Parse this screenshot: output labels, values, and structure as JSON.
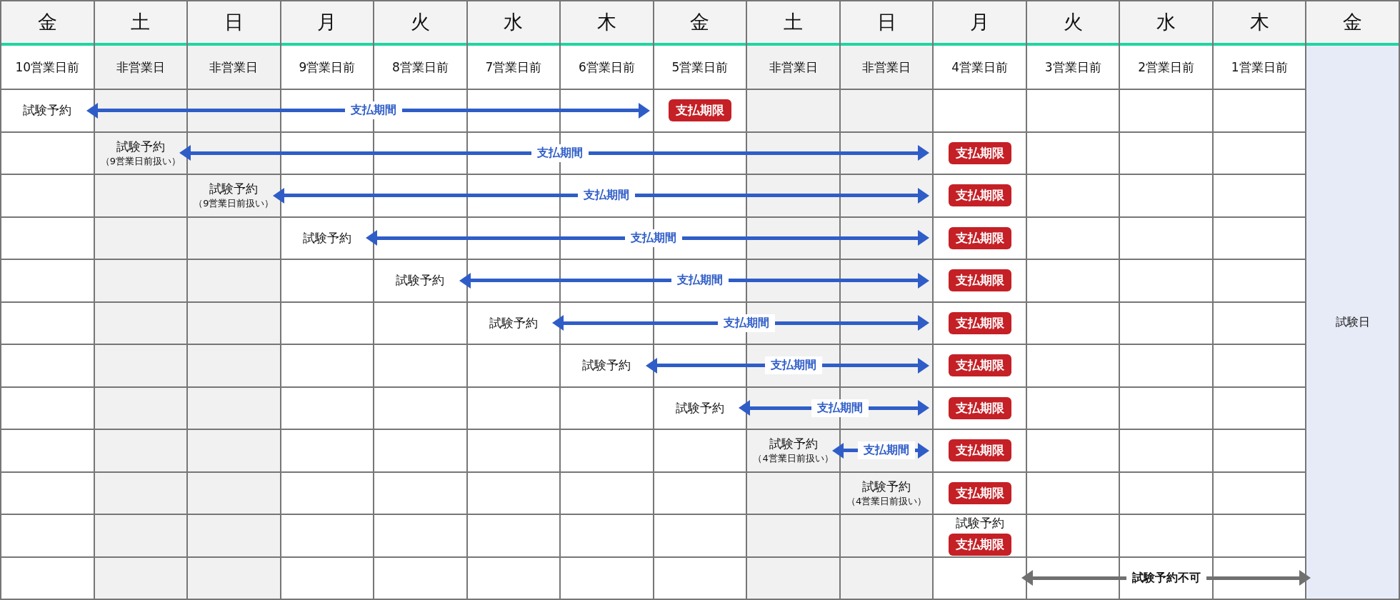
{
  "days": [
    {
      "weekday": "金",
      "offset": "10営業日前",
      "business": true
    },
    {
      "weekday": "土",
      "offset": "非営業日",
      "business": false
    },
    {
      "weekday": "日",
      "offset": "非営業日",
      "business": false
    },
    {
      "weekday": "月",
      "offset": "9営業日前",
      "business": true
    },
    {
      "weekday": "火",
      "offset": "8営業日前",
      "business": true
    },
    {
      "weekday": "水",
      "offset": "7営業日前",
      "business": true
    },
    {
      "weekday": "木",
      "offset": "6営業日前",
      "business": true
    },
    {
      "weekday": "金",
      "offset": "5営業日前",
      "business": true
    },
    {
      "weekday": "土",
      "offset": "非営業日",
      "business": false
    },
    {
      "weekday": "日",
      "offset": "非営業日",
      "business": false
    },
    {
      "weekday": "月",
      "offset": "4営業日前",
      "business": true
    },
    {
      "weekday": "火",
      "offset": "3営業日前",
      "business": true
    },
    {
      "weekday": "水",
      "offset": "2営業日前",
      "business": true
    },
    {
      "weekday": "木",
      "offset": "1営業日前",
      "business": true
    }
  ],
  "exam_day": {
    "weekday": "金",
    "label": "試験日"
  },
  "rows": [
    {
      "cells": [
        {
          "kind": "booking"
        },
        {
          "kind": "period"
        },
        {
          "kind": "period"
        },
        {
          "kind": "period"
        },
        {
          "kind": "period"
        },
        {
          "kind": "period"
        },
        {
          "kind": "period"
        },
        {
          "kind": "deadline"
        },
        {
          "kind": "empty"
        },
        {
          "kind": "empty"
        },
        {
          "kind": "empty"
        },
        {
          "kind": "empty"
        },
        {
          "kind": "empty"
        },
        {
          "kind": "empty"
        }
      ],
      "booking": {
        "label": "試験予約"
      },
      "period": "支払期間",
      "deadline": "支払期限"
    },
    {
      "cells": [
        {
          "kind": "empty"
        },
        {
          "kind": "booking"
        },
        {
          "kind": "period"
        },
        {
          "kind": "period"
        },
        {
          "kind": "period"
        },
        {
          "kind": "period"
        },
        {
          "kind": "period"
        },
        {
          "kind": "period"
        },
        {
          "kind": "period"
        },
        {
          "kind": "period"
        },
        {
          "kind": "deadline"
        },
        {
          "kind": "empty"
        },
        {
          "kind": "empty"
        },
        {
          "kind": "empty"
        }
      ],
      "booking": {
        "label": "試験予約",
        "note": "（9営業日前扱い）"
      },
      "period": "支払期間",
      "deadline": "支払期限"
    },
    {
      "cells": [
        {
          "kind": "empty"
        },
        {
          "kind": "empty"
        },
        {
          "kind": "booking"
        },
        {
          "kind": "period"
        },
        {
          "kind": "period"
        },
        {
          "kind": "period"
        },
        {
          "kind": "period"
        },
        {
          "kind": "period"
        },
        {
          "kind": "period"
        },
        {
          "kind": "period"
        },
        {
          "kind": "deadline"
        },
        {
          "kind": "empty"
        },
        {
          "kind": "empty"
        },
        {
          "kind": "empty"
        }
      ],
      "booking": {
        "label": "試験予約",
        "note": "（9営業日前扱い）"
      },
      "period": "支払期間",
      "deadline": "支払期限"
    },
    {
      "cells": [
        {
          "kind": "empty"
        },
        {
          "kind": "empty"
        },
        {
          "kind": "empty"
        },
        {
          "kind": "booking"
        },
        {
          "kind": "period"
        },
        {
          "kind": "period"
        },
        {
          "kind": "period"
        },
        {
          "kind": "period"
        },
        {
          "kind": "period"
        },
        {
          "kind": "period"
        },
        {
          "kind": "deadline"
        },
        {
          "kind": "empty"
        },
        {
          "kind": "empty"
        },
        {
          "kind": "empty"
        }
      ],
      "booking": {
        "label": "試験予約"
      },
      "period": "支払期間",
      "deadline": "支払期限"
    },
    {
      "cells": [
        {
          "kind": "empty"
        },
        {
          "kind": "empty"
        },
        {
          "kind": "empty"
        },
        {
          "kind": "empty"
        },
        {
          "kind": "booking"
        },
        {
          "kind": "period"
        },
        {
          "kind": "period"
        },
        {
          "kind": "period"
        },
        {
          "kind": "period"
        },
        {
          "kind": "period"
        },
        {
          "kind": "deadline"
        },
        {
          "kind": "empty"
        },
        {
          "kind": "empty"
        },
        {
          "kind": "empty"
        }
      ],
      "booking": {
        "label": "試験予約"
      },
      "period": "支払期間",
      "deadline": "支払期限"
    },
    {
      "cells": [
        {
          "kind": "empty"
        },
        {
          "kind": "empty"
        },
        {
          "kind": "empty"
        },
        {
          "kind": "empty"
        },
        {
          "kind": "empty"
        },
        {
          "kind": "booking"
        },
        {
          "kind": "period"
        },
        {
          "kind": "period"
        },
        {
          "kind": "period"
        },
        {
          "kind": "period"
        },
        {
          "kind": "deadline"
        },
        {
          "kind": "empty"
        },
        {
          "kind": "empty"
        },
        {
          "kind": "empty"
        }
      ],
      "booking": {
        "label": "試験予約"
      },
      "period": "支払期間",
      "deadline": "支払期限"
    },
    {
      "cells": [
        {
          "kind": "empty"
        },
        {
          "kind": "empty"
        },
        {
          "kind": "empty"
        },
        {
          "kind": "empty"
        },
        {
          "kind": "empty"
        },
        {
          "kind": "empty"
        },
        {
          "kind": "booking"
        },
        {
          "kind": "period"
        },
        {
          "kind": "period"
        },
        {
          "kind": "period"
        },
        {
          "kind": "deadline"
        },
        {
          "kind": "empty"
        },
        {
          "kind": "empty"
        },
        {
          "kind": "empty"
        }
      ],
      "booking": {
        "label": "試験予約"
      },
      "period": "支払期間",
      "deadline": "支払期限"
    },
    {
      "cells": [
        {
          "kind": "empty"
        },
        {
          "kind": "empty"
        },
        {
          "kind": "empty"
        },
        {
          "kind": "empty"
        },
        {
          "kind": "empty"
        },
        {
          "kind": "empty"
        },
        {
          "kind": "empty"
        },
        {
          "kind": "booking"
        },
        {
          "kind": "period"
        },
        {
          "kind": "period"
        },
        {
          "kind": "deadline"
        },
        {
          "kind": "empty"
        },
        {
          "kind": "empty"
        },
        {
          "kind": "empty"
        }
      ],
      "booking": {
        "label": "試験予約"
      },
      "period": "支払期間",
      "deadline": "支払期限"
    },
    {
      "cells": [
        {
          "kind": "empty"
        },
        {
          "kind": "empty"
        },
        {
          "kind": "empty"
        },
        {
          "kind": "empty"
        },
        {
          "kind": "empty"
        },
        {
          "kind": "empty"
        },
        {
          "kind": "empty"
        },
        {
          "kind": "empty"
        },
        {
          "kind": "booking"
        },
        {
          "kind": "period"
        },
        {
          "kind": "deadline"
        },
        {
          "kind": "empty"
        },
        {
          "kind": "empty"
        },
        {
          "kind": "empty"
        }
      ],
      "booking": {
        "label": "試験予約",
        "note": "（4営業日前扱い）"
      },
      "period": "支払期間",
      "deadline": "支払期限"
    },
    {
      "cells": [
        {
          "kind": "empty"
        },
        {
          "kind": "empty"
        },
        {
          "kind": "empty"
        },
        {
          "kind": "empty"
        },
        {
          "kind": "empty"
        },
        {
          "kind": "empty"
        },
        {
          "kind": "empty"
        },
        {
          "kind": "empty"
        },
        {
          "kind": "empty"
        },
        {
          "kind": "booking"
        },
        {
          "kind": "deadline"
        },
        {
          "kind": "empty"
        },
        {
          "kind": "empty"
        },
        {
          "kind": "empty"
        }
      ],
      "booking": {
        "label": "試験予約",
        "note": "（4営業日前扱い）"
      },
      "deadline": "支払期限"
    },
    {
      "cells": [
        {
          "kind": "empty"
        },
        {
          "kind": "empty"
        },
        {
          "kind": "empty"
        },
        {
          "kind": "empty"
        },
        {
          "kind": "empty"
        },
        {
          "kind": "empty"
        },
        {
          "kind": "empty"
        },
        {
          "kind": "empty"
        },
        {
          "kind": "empty"
        },
        {
          "kind": "empty"
        },
        {
          "kind": "both"
        },
        {
          "kind": "empty"
        },
        {
          "kind": "empty"
        },
        {
          "kind": "empty"
        }
      ],
      "booking": {
        "label": "試験予約"
      },
      "deadline": "支払期限"
    },
    {
      "cells": [
        {
          "kind": "empty"
        },
        {
          "kind": "empty"
        },
        {
          "kind": "empty"
        },
        {
          "kind": "empty"
        },
        {
          "kind": "empty"
        },
        {
          "kind": "empty"
        },
        {
          "kind": "empty"
        },
        {
          "kind": "empty"
        },
        {
          "kind": "empty"
        },
        {
          "kind": "empty"
        },
        {
          "kind": "empty"
        },
        {
          "kind": "blocked"
        },
        {
          "kind": "blocked"
        },
        {
          "kind": "blocked"
        }
      ],
      "blocked": "試験予約不可"
    }
  ]
}
